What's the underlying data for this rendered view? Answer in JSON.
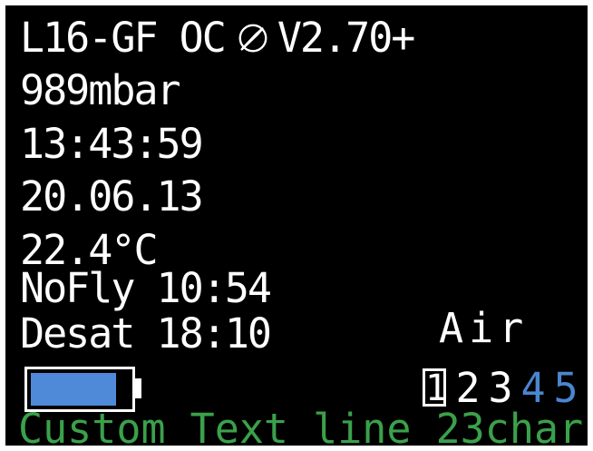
{
  "header": {
    "model": "L16-GF OC",
    "compass_icon": "compass-icon",
    "version": "V2.70+"
  },
  "status": {
    "pressure": "989mbar",
    "time": "13:43:59",
    "date": "20.06.13",
    "temperature": "22.4°C",
    "nofly": "NoFly 10:54",
    "desat": "Desat 18:10"
  },
  "gas": {
    "label": "Air",
    "slots": [
      "1",
      "2",
      "3",
      "4",
      "5"
    ],
    "selected_index": 0
  },
  "battery": {
    "level_fraction": 0.87,
    "fill_color": "#4f8ad9"
  },
  "colors": {
    "background": "#000000",
    "text": "#ffffff",
    "custom_text": "#3aa14a",
    "inactive_gas": "#4a86d0"
  },
  "custom_text": "Custom Text line 23char"
}
